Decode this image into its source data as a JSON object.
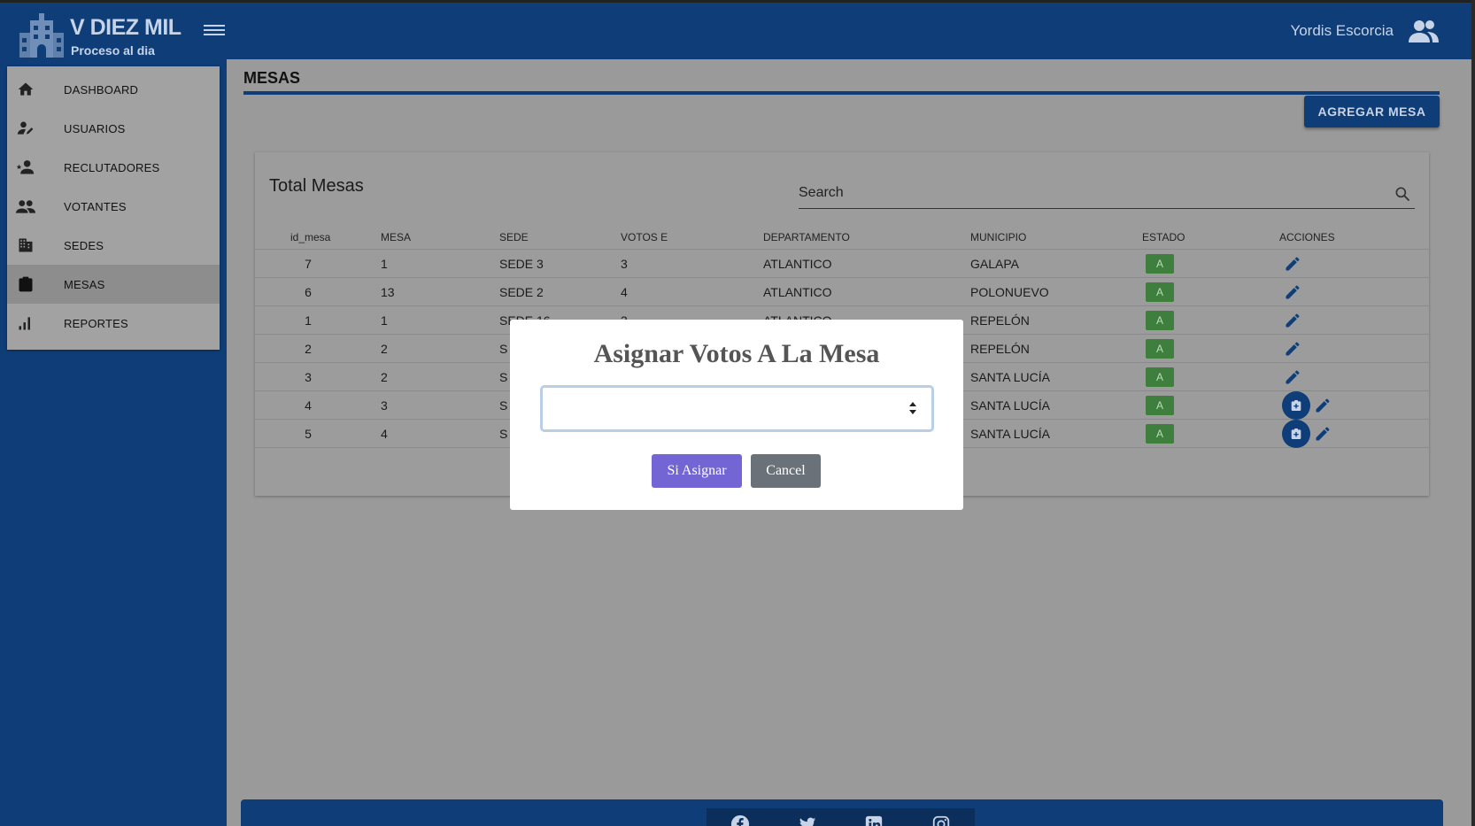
{
  "header": {
    "brand": "V DIEZ MIL",
    "brand_sub": "Proceso al dia",
    "user_name": "Yordis Escorcia"
  },
  "sidebar": {
    "items": [
      {
        "label": "DASHBOARD",
        "icon": "home-icon"
      },
      {
        "label": "USUARIOS",
        "icon": "user-edit-icon"
      },
      {
        "label": "RECLUTADORES",
        "icon": "user-star-icon"
      },
      {
        "label": "VOTANTES",
        "icon": "people-icon"
      },
      {
        "label": "SEDES",
        "icon": "building-icon"
      },
      {
        "label": "MESAS",
        "icon": "clipboard-icon",
        "active": true
      },
      {
        "label": "REPORTES",
        "icon": "bar-chart-icon"
      }
    ]
  },
  "main": {
    "title": "MESAS",
    "add_button": "AGREGAR MESA",
    "card_title": "Total Mesas",
    "search_placeholder": "Search"
  },
  "table": {
    "columns": [
      "id_mesa",
      "MESA",
      "SEDE",
      "VOTOS E",
      "DEPARTAMENTO",
      "MUNICIPIO",
      "ESTADO",
      "ACCIONES"
    ],
    "rows": [
      {
        "id_mesa": "7",
        "mesa": "1",
        "sede": "SEDE 3",
        "votos": "3",
        "departamento": "ATLANTICO",
        "municipio": "GALAPA",
        "estado": "A",
        "vote_action": false
      },
      {
        "id_mesa": "6",
        "mesa": "13",
        "sede": "SEDE 2",
        "votos": "4",
        "departamento": "ATLANTICO",
        "municipio": "POLONUEVO",
        "estado": "A",
        "vote_action": false
      },
      {
        "id_mesa": "1",
        "mesa": "1",
        "sede": "SEDE 16",
        "votos": "3",
        "departamento": "ATLANTICO",
        "municipio": "REPELÓN",
        "estado": "A",
        "vote_action": false
      },
      {
        "id_mesa": "2",
        "mesa": "2",
        "sede": "S",
        "votos": "",
        "departamento": "",
        "municipio": "REPELÓN",
        "estado": "A",
        "vote_action": false
      },
      {
        "id_mesa": "3",
        "mesa": "2",
        "sede": "S",
        "votos": "",
        "departamento": "",
        "municipio": "SANTA LUCÍA",
        "estado": "A",
        "vote_action": false
      },
      {
        "id_mesa": "4",
        "mesa": "3",
        "sede": "S",
        "votos": "",
        "departamento": "",
        "municipio": "SANTA LUCÍA",
        "estado": "A",
        "vote_action": true
      },
      {
        "id_mesa": "5",
        "mesa": "4",
        "sede": "S",
        "votos": "",
        "departamento": "",
        "municipio": "SANTA LUCÍA",
        "estado": "A",
        "vote_action": true
      }
    ]
  },
  "modal": {
    "title": "Asignar Votos A La Mesa",
    "input_value": "",
    "confirm_label": "Si Asignar",
    "cancel_label": "Cancel"
  },
  "footer": {
    "social_icons": [
      "facebook-icon",
      "twitter-icon",
      "linkedin-icon",
      "instagram-icon"
    ]
  },
  "colors": {
    "primary": "#0f3d78",
    "badge_green": "#3e7f3e",
    "confirm_purple": "#7366d4",
    "cancel_gray": "#6b7178"
  }
}
